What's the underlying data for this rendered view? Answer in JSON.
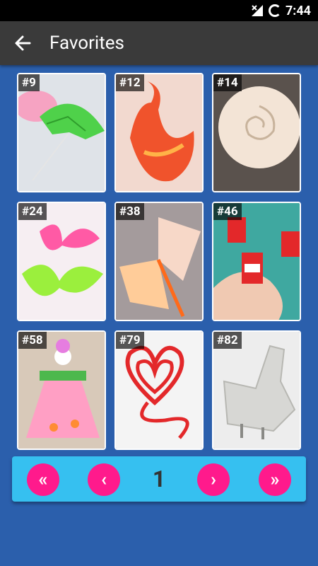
{
  "status": {
    "time": "7:44"
  },
  "appbar": {
    "title": "Favorites"
  },
  "tiles": [
    {
      "num": "#9"
    },
    {
      "num": "#12"
    },
    {
      "num": "#14"
    },
    {
      "num": "#24"
    },
    {
      "num": "#38"
    },
    {
      "num": "#46"
    },
    {
      "num": "#58"
    },
    {
      "num": "#79"
    },
    {
      "num": "#82"
    }
  ],
  "pager": {
    "first": "«",
    "prev": "‹",
    "page": "1",
    "next": "›",
    "last": "»"
  }
}
